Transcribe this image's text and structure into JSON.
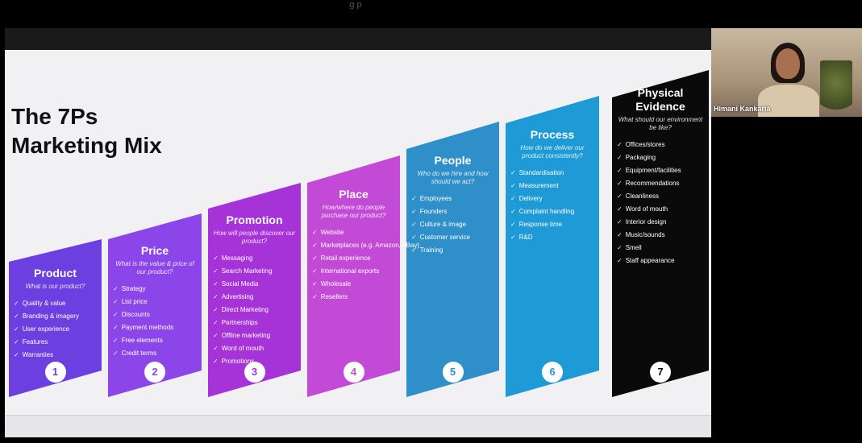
{
  "top_caption": "g p",
  "slide": {
    "title": "The 7Ps Marketing Mix"
  },
  "cards": [
    {
      "number": "1",
      "title": "Product",
      "question": "What is our product?",
      "items": [
        "Quality & value",
        "Branding & imagery",
        "User experience",
        "Features",
        "Warranties"
      ],
      "color": "#6b3fe0"
    },
    {
      "number": "2",
      "title": "Price",
      "question": "What is the value & price of our product?",
      "items": [
        "Strategy",
        "List price",
        "Discounts",
        "Payment methods",
        "Free elements",
        "Credit terms"
      ],
      "color": "#8b45e8"
    },
    {
      "number": "3",
      "title": "Promotion",
      "question": "How will people discover our product?",
      "items": [
        "Messaging",
        "Search Marketing",
        "Social Media",
        "Advertising",
        "Direct Marketing",
        "Partnerships",
        "Offline marketing",
        "Word of mouth",
        "Promotions"
      ],
      "color": "#a533d8"
    },
    {
      "number": "4",
      "title": "Place",
      "question": "How/where do people purchase our product?",
      "items": [
        "Website",
        "Marketplaces (e.g. Amazon, eBay)",
        "Retail experience",
        "International exports",
        "Wholesale",
        "Resellers"
      ],
      "color": "#c24ad6"
    },
    {
      "number": "5",
      "title": "People",
      "question": "Who do we hire and how should we act?",
      "items": [
        "Employees",
        "Founders",
        "Culture & image",
        "Customer service",
        "Training"
      ],
      "color": "#2f8fc9"
    },
    {
      "number": "6",
      "title": "Process",
      "question": "How do we deliver our product consistently?",
      "items": [
        "Standardisation",
        "Measurement",
        "Delivery",
        "Complaint handling",
        "Response time",
        "R&D"
      ],
      "color": "#1e9ad6"
    },
    {
      "number": "7",
      "title": "Physical Evidence",
      "question": "What should our environment be like?",
      "items": [
        "Offices/stores",
        "Packaging",
        "Equipment/facilities",
        "Recommendations",
        "Cleanliness",
        "Word of mouth",
        "Interior design",
        "Music/sounds",
        "Smell",
        "Staff appearance"
      ],
      "color": "#0a0a0a"
    }
  ],
  "participant": {
    "name": "Himani Kankaria"
  }
}
